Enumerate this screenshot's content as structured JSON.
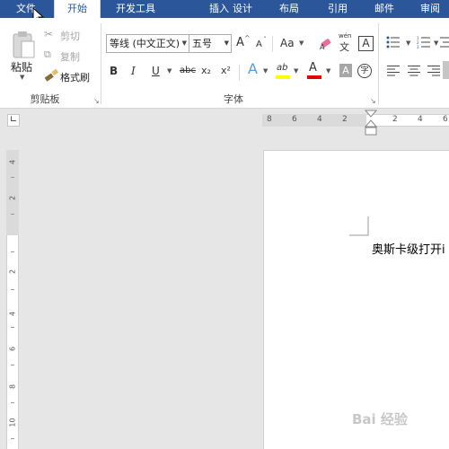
{
  "tabs": [
    {
      "label": "文件",
      "active": false
    },
    {
      "label": "开始",
      "active": true
    },
    {
      "label": "开发工具",
      "active": false
    },
    {
      "label": "插入",
      "active": false
    },
    {
      "label": "设计",
      "active": false
    },
    {
      "label": "布局",
      "active": false
    },
    {
      "label": "引用",
      "active": false
    },
    {
      "label": "邮件",
      "active": false
    },
    {
      "label": "审阅",
      "active": false
    }
  ],
  "clipboard": {
    "paste": "粘贴",
    "cut": "剪切",
    "copy": "复制",
    "format_painter": "格式刷",
    "group_label": "剪贴板"
  },
  "font": {
    "font_name": "等线 (中文正文)",
    "font_size": "五号",
    "change_case": "Aa",
    "phonetic": "wén",
    "phonetic_char": "文",
    "border_char": "A",
    "bold": "B",
    "italic": "I",
    "underline": "U",
    "strikethrough": "abc",
    "subscript": "x₂",
    "superscript": "x²",
    "effects": "A",
    "highlight": "ab",
    "font_color": "A",
    "shading": "A",
    "enclose": "字",
    "grow": "A",
    "shrink": "A",
    "group_label": "字体"
  },
  "colors": {
    "tabbar": "#2b579a",
    "highlight_bar": "#ffff00",
    "font_color_bar": "#e00000"
  },
  "ruler": {
    "horizontal": [
      "8",
      "6",
      "4",
      "2",
      "2",
      "4",
      "6"
    ],
    "vertical": [
      "4",
      "2",
      "2",
      "4",
      "6",
      "8",
      "10"
    ]
  },
  "document": {
    "text": "奥斯卡级打开i"
  },
  "watermark": "Bai 经验"
}
